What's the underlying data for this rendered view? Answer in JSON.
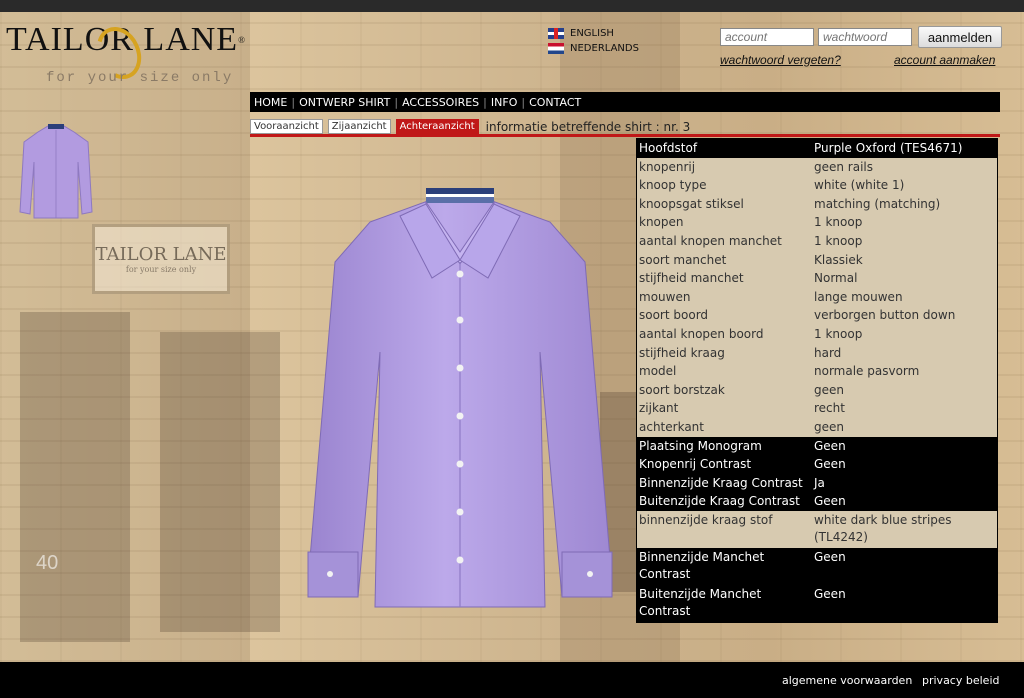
{
  "brand": {
    "name": "TAILOR LANE",
    "registered": "®",
    "tagline": "for your size only"
  },
  "languages": [
    {
      "label": "ENGLISH",
      "flag": "uk-flag-icon"
    },
    {
      "label": "NEDERLANDS",
      "flag": "nl-flag-icon"
    }
  ],
  "login": {
    "account_placeholder": "account",
    "password_placeholder": "wachtwoord",
    "submit_label": "aanmelden",
    "forgot_label": "wachtwoord vergeten?",
    "create_label": "account aanmaken"
  },
  "nav": {
    "items": [
      "HOME",
      "ONTWERP SHIRT",
      "ACCESSOIRES",
      "INFO",
      "CONTACT"
    ],
    "separator": "|"
  },
  "views": {
    "tabs": [
      "Vooraanzicht",
      "Zijaanzicht",
      "Achteraanzicht"
    ],
    "active_index": 2,
    "info_title": "informatie betreffende shirt : nr. 3"
  },
  "background_sign": {
    "text": "TAILOR LANE",
    "small": "for your size only",
    "number": "40"
  },
  "shirt": {
    "color": "#b29be0",
    "collar_stripe_colors": [
      "#2b3f7a",
      "#ffffff",
      "#5a6fa8"
    ]
  },
  "spec_rows": [
    {
      "key": "Hoofdstof",
      "value": "Purple Oxford (TES4671)",
      "style": "dark"
    },
    {
      "key": "knopenrij",
      "value": "geen rails",
      "style": "light"
    },
    {
      "key": "knoop type",
      "value": "white (white 1)",
      "style": "light"
    },
    {
      "key": "knoopsgat stiksel",
      "value": "matching (matching)",
      "style": "light"
    },
    {
      "key": "knopen",
      "value": "1 knoop",
      "style": "light"
    },
    {
      "key": "aantal knopen manchet",
      "value": "1 knoop",
      "style": "light"
    },
    {
      "key": "soort manchet",
      "value": "Klassiek",
      "style": "light"
    },
    {
      "key": "stijfheid manchet",
      "value": "Normal",
      "style": "light"
    },
    {
      "key": "mouwen",
      "value": "lange mouwen",
      "style": "light"
    },
    {
      "key": "soort boord",
      "value": "verborgen button down",
      "style": "light"
    },
    {
      "key": "aantal knopen boord",
      "value": "1 knoop",
      "style": "light"
    },
    {
      "key": "stijfheid kraag",
      "value": "hard",
      "style": "light"
    },
    {
      "key": "model",
      "value": "normale pasvorm",
      "style": "light"
    },
    {
      "key": "soort borstzak",
      "value": "geen",
      "style": "light"
    },
    {
      "key": "zijkant",
      "value": "recht",
      "style": "light"
    },
    {
      "key": "achterkant",
      "value": "geen",
      "style": "light"
    },
    {
      "key": "Plaatsing Monogram",
      "value": "Geen",
      "style": "dark"
    },
    {
      "key": "Knopenrij Contrast",
      "value": "Geen",
      "style": "dark"
    },
    {
      "key": "Binnenzijde Kraag Contrast",
      "value": "Ja",
      "style": "dark"
    },
    {
      "key": "Buitenzijde Kraag Contrast",
      "value": "Geen",
      "style": "dark"
    },
    {
      "key": "binnenzijde kraag stof",
      "value": "white dark blue stripes (TL4242)",
      "style": "light"
    },
    {
      "key": "Binnenzijde Manchet Contrast",
      "value": "Geen",
      "style": "dark"
    },
    {
      "key": "Buitenzijde Manchet Contrast",
      "value": "Geen",
      "style": "dark"
    }
  ],
  "footer": {
    "terms": "algemene voorwaarden",
    "privacy": "privacy beleid"
  }
}
